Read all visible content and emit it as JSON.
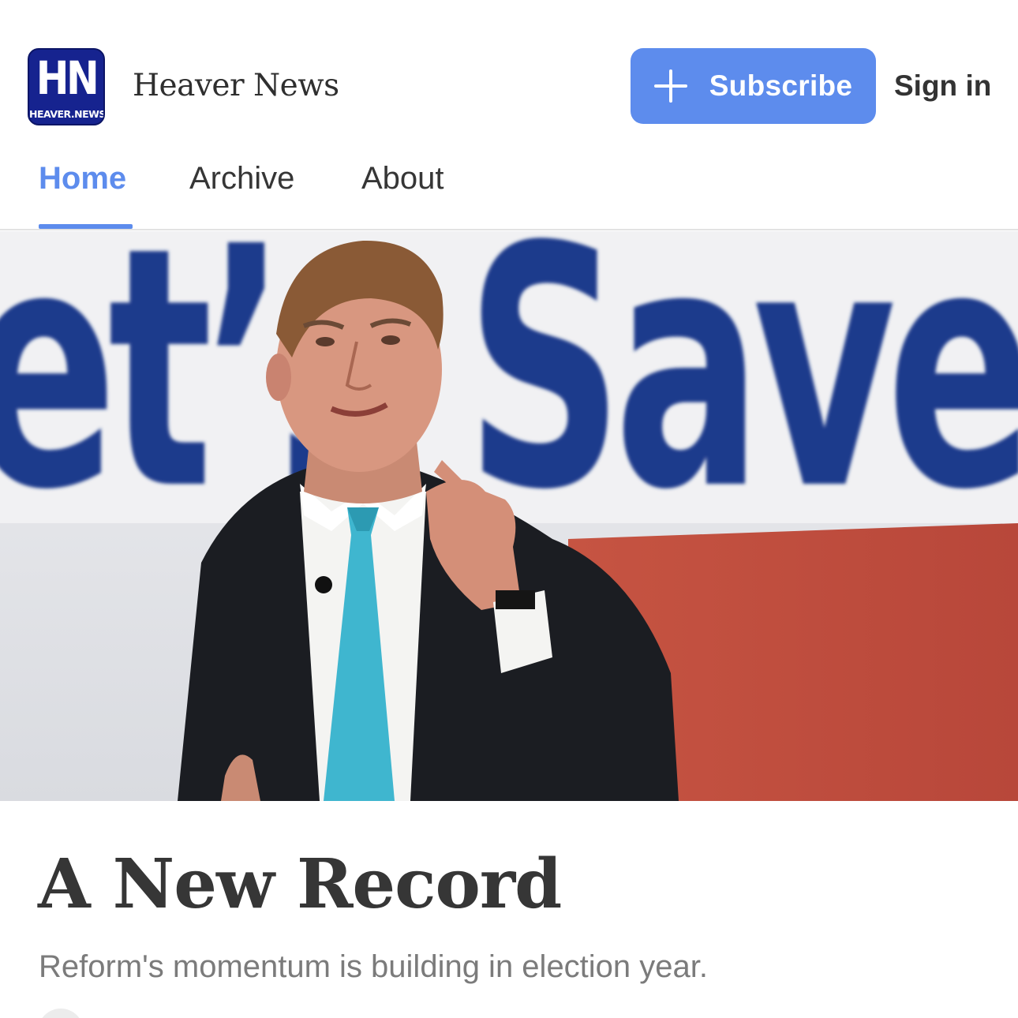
{
  "header": {
    "logo": {
      "monogram": "HN",
      "domain": "HEAVER.NEWS",
      "color": "#16238f"
    },
    "publication_name": "Heaver News",
    "subscribe_button": {
      "label": "Subscribe",
      "icon": "plus-icon",
      "color": "#5d8ced"
    },
    "signin_label": "Sign in"
  },
  "nav": {
    "tabs": [
      {
        "label": "Home",
        "active": true
      },
      {
        "label": "Archive",
        "active": false
      },
      {
        "label": "About",
        "active": false
      }
    ],
    "accent_color": "#5d8ced"
  },
  "hero": {
    "alt": "Speaker in dark suit and light blue tie pointing in front of a banner",
    "banner_text": "et’s Save",
    "banner_text_color": "#1f3a8c",
    "banner_lower_color": "#c0493a"
  },
  "article": {
    "title": "A New Record",
    "subtitle": "Reform's momentum is building in election year."
  }
}
